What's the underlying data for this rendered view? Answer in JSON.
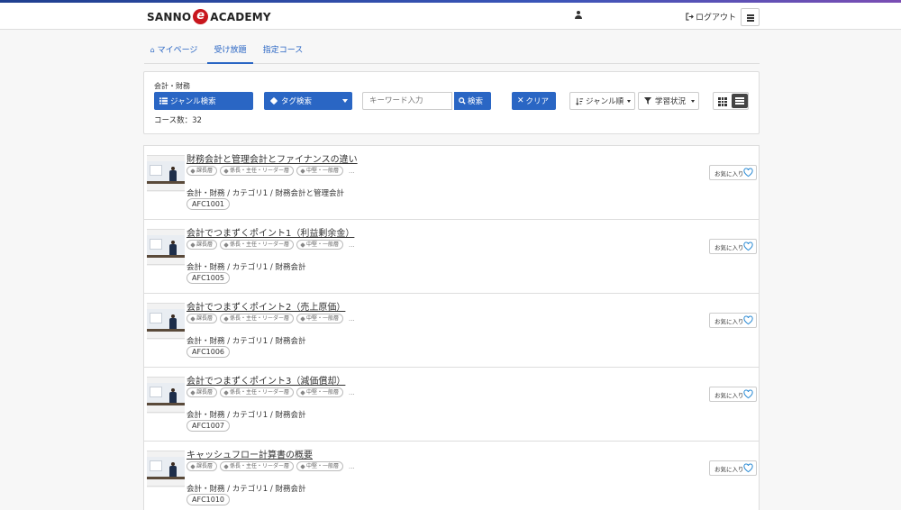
{
  "header": {
    "logo_left": "SANNO",
    "logo_mark": "e",
    "logo_right": "ACADEMY",
    "logout_label": "ログアウト"
  },
  "tabs": [
    {
      "label": "マイページ",
      "active": false
    },
    {
      "label": "受け放題",
      "active": true
    },
    {
      "label": "指定コース",
      "active": false
    }
  ],
  "filter": {
    "breadcrumb": "会計・財務",
    "genre_search_label": "ジャンル検索",
    "tag_search_label": "タグ検索",
    "keyword_placeholder": "キーワード入力",
    "search_label": "検索",
    "clear_label": "クリア",
    "sort_label": "ジャンル順",
    "status_label": "学習状況",
    "course_count": "コース数：32"
  },
  "colors": {
    "accent": "#2a66c4",
    "favorite_heart": "#2a8ad4"
  },
  "courses": [
    {
      "title": "財務会計と管理会計とファイナンスの違い",
      "tags": [
        "課長層",
        "係長・主任・リーダー層",
        "中堅・一般層"
      ],
      "more": "...",
      "path": "会計・財務 / カテゴリ1 / 財務会計と管理会計",
      "code": "AFC1001",
      "fav_label": "お気に入り"
    },
    {
      "title": "会計でつまずくポイント1（利益剰余金）",
      "tags": [
        "課長層",
        "係長・主任・リーダー層",
        "中堅・一般層"
      ],
      "more": "...",
      "path": "会計・財務 / カテゴリ1 / 財務会計",
      "code": "AFC1005",
      "fav_label": "お気に入り"
    },
    {
      "title": "会計でつまずくポイント2（売上原価）",
      "tags": [
        "課長層",
        "係長・主任・リーダー層",
        "中堅・一般層"
      ],
      "more": "...",
      "path": "会計・財務 / カテゴリ1 / 財務会計",
      "code": "AFC1006",
      "fav_label": "お気に入り"
    },
    {
      "title": "会計でつまずくポイント3（減価償却）",
      "tags": [
        "課長層",
        "係長・主任・リーダー層",
        "中堅・一般層"
      ],
      "more": "...",
      "path": "会計・財務 / カテゴリ1 / 財務会計",
      "code": "AFC1007",
      "fav_label": "お気に入り"
    },
    {
      "title": "キャッシュフロー計算書の概要",
      "tags": [
        "課長層",
        "係長・主任・リーダー層",
        "中堅・一般層"
      ],
      "more": "...",
      "path": "会計・財務 / カテゴリ1 / 財務会計",
      "code": "AFC1010",
      "fav_label": "お気に入り"
    }
  ]
}
